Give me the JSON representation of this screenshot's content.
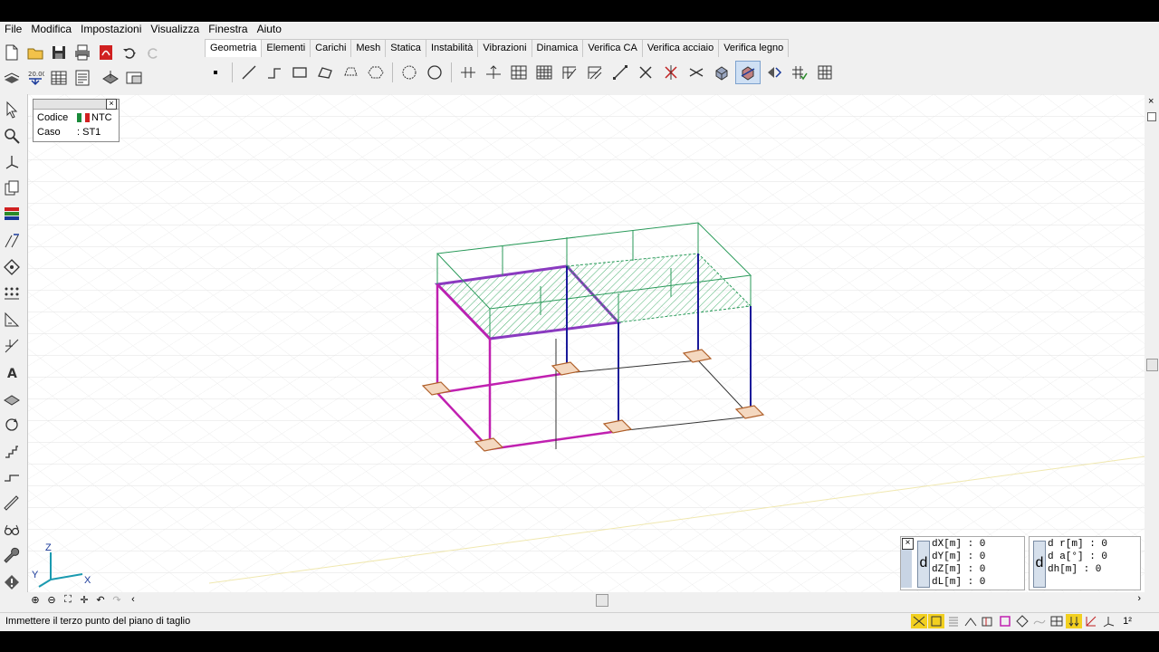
{
  "menu": [
    "File",
    "Modifica",
    "Impostazioni",
    "Visualizza",
    "Finestra",
    "Aiuto"
  ],
  "tabs": [
    "Geometria",
    "Elementi",
    "Carichi",
    "Mesh",
    "Statica",
    "Instabilità",
    "Vibrazioni",
    "Dinamica",
    "Verifica CA",
    "Verifica acciaio",
    "Verifica legno"
  ],
  "active_tab": "Geometria",
  "info_box": {
    "codice_label": "Codice",
    "codice_value": "NTC",
    "caso_label": "Caso",
    "caso_value": ": ST1"
  },
  "axes": {
    "z": "Z",
    "y": "Y",
    "x": "X"
  },
  "delta_left": {
    "badge": "d",
    "lines": [
      "dX[m] : 0",
      "dY[m] : 0",
      "dZ[m] : 0",
      "dL[m] : 0"
    ]
  },
  "delta_right": {
    "badge": "d",
    "lines": [
      "d r[m] : 0",
      "d a[°] : 0",
      "dh[m] : 0"
    ]
  },
  "status": {
    "message": "Immettere il terzo punto del piano di taglio",
    "power_label": "1²"
  },
  "colors": {
    "frame_magenta": "#c020b0",
    "frame_blue": "#1a1a9a",
    "load_green": "#2a9a5a",
    "support_brown": "#b0602a",
    "grid": "#e2e2e2"
  }
}
